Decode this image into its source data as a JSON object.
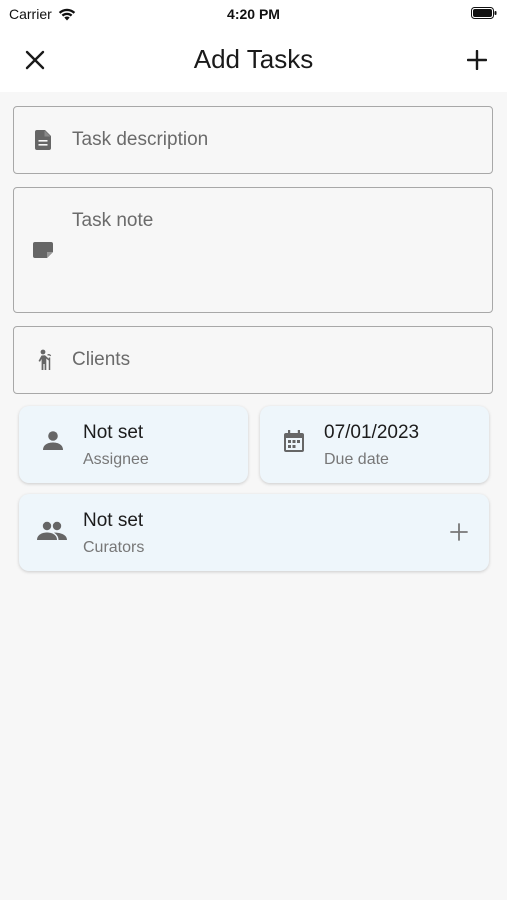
{
  "status_bar": {
    "carrier": "Carrier",
    "time": "4:20 PM"
  },
  "header": {
    "title": "Add Tasks",
    "close_icon": "close-icon",
    "add_icon": "plus-icon"
  },
  "form": {
    "task_description": {
      "placeholder": "Task description",
      "icon": "document-icon"
    },
    "task_note": {
      "placeholder": "Task note",
      "icon": "note-icon"
    },
    "clients": {
      "placeholder": "Clients",
      "icon": "person-cane-icon"
    }
  },
  "cards": {
    "assignee": {
      "value": "Not set",
      "label": "Assignee",
      "icon": "person-icon"
    },
    "due_date": {
      "value": "07/01/2023",
      "label": "Due date",
      "icon": "calendar-icon"
    },
    "curators": {
      "value": "Not set",
      "label": "Curators",
      "icon": "group-icon",
      "action_icon": "plus-icon"
    }
  },
  "colors": {
    "card_background": "#eef6fb",
    "field_border": "#a8a8a8",
    "icon_gray": "#666666"
  }
}
